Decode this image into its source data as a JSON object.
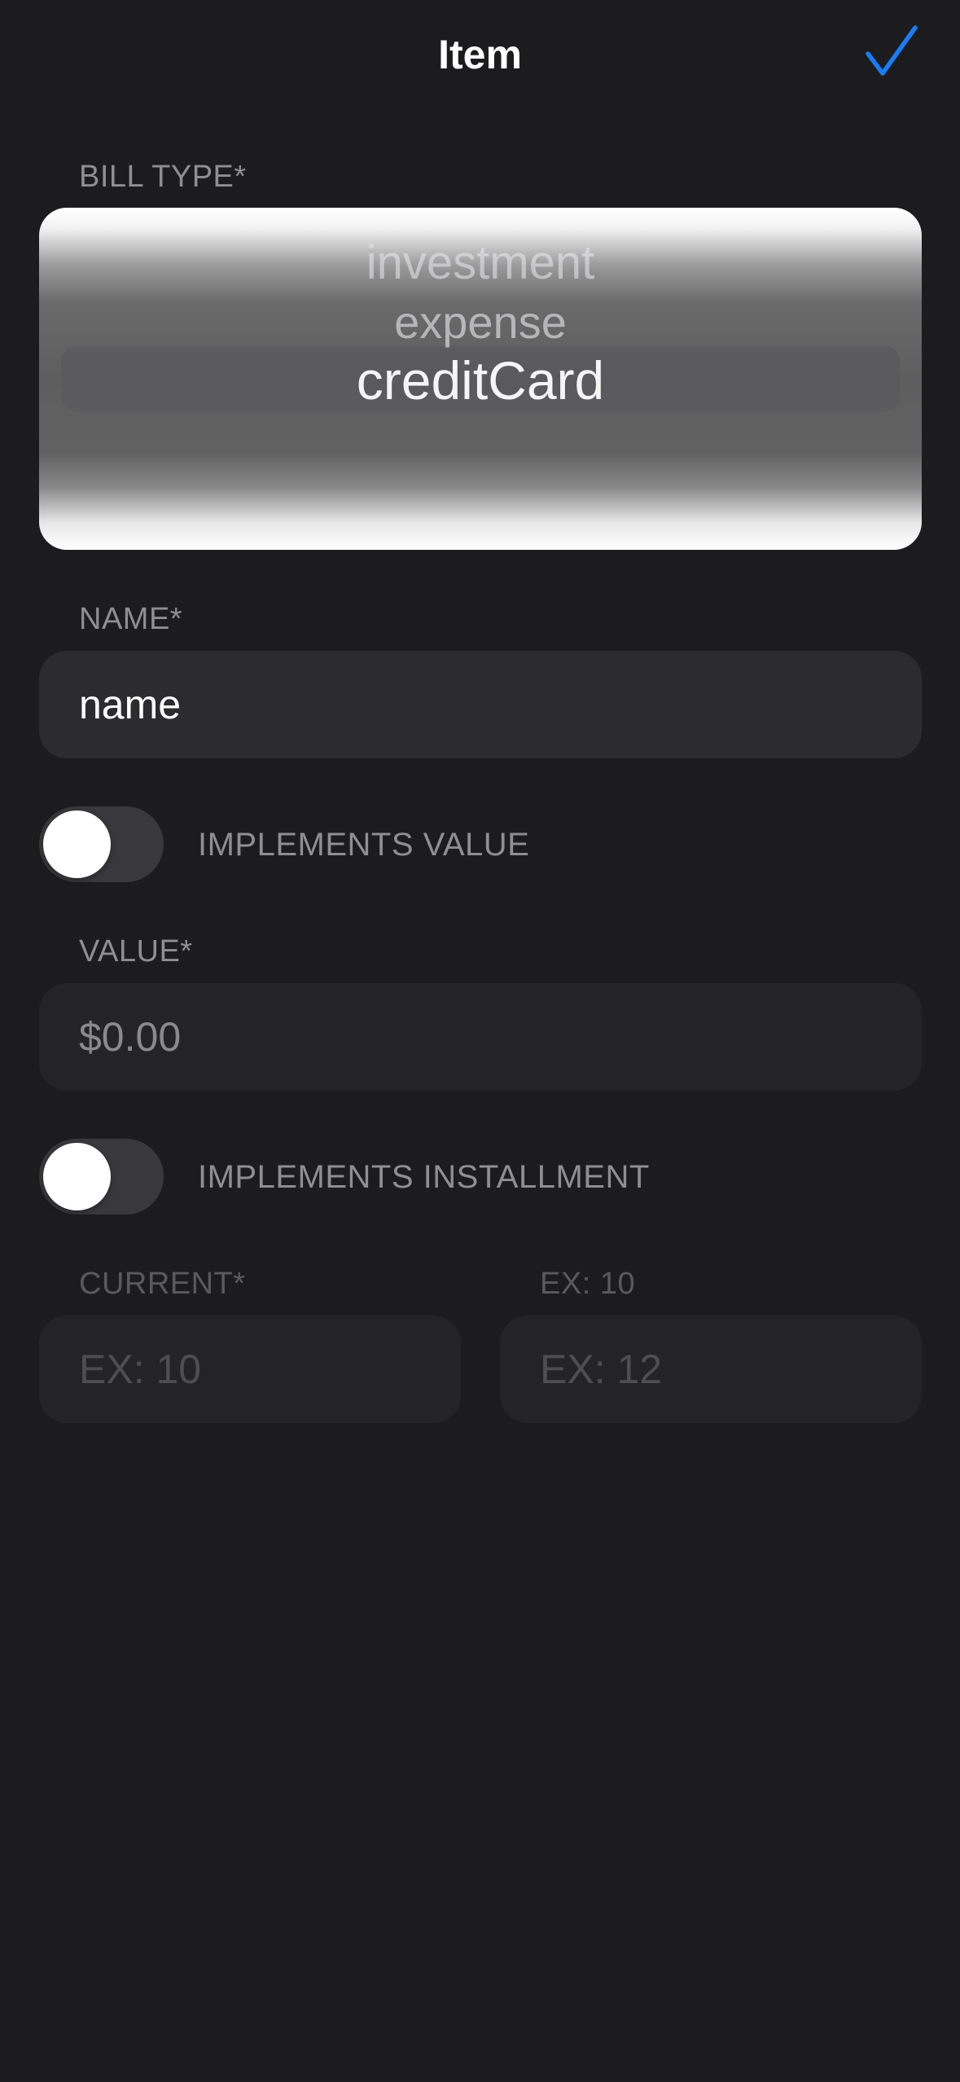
{
  "nav": {
    "title": "Item",
    "done_icon": "checkmark-icon",
    "accent_color": "#1a7cf5"
  },
  "bill_type": {
    "label": "BILL TYPE*",
    "options": [
      "investment",
      "expense",
      "creditCard"
    ],
    "selected": "creditCard"
  },
  "name_field": {
    "label": "NAME*",
    "value": "name"
  },
  "implements_value": {
    "label": "IMPLEMENTS VALUE",
    "on": false
  },
  "value_field": {
    "label": "VALUE*",
    "value": "$0.00"
  },
  "implements_installment": {
    "label": "IMPLEMENTS INSTALLMENT",
    "on": false
  },
  "installment": {
    "current_label": "CURRENT*",
    "current_placeholder": "EX: 10",
    "total_label": "EX: 10",
    "total_placeholder": "EX: 12"
  }
}
